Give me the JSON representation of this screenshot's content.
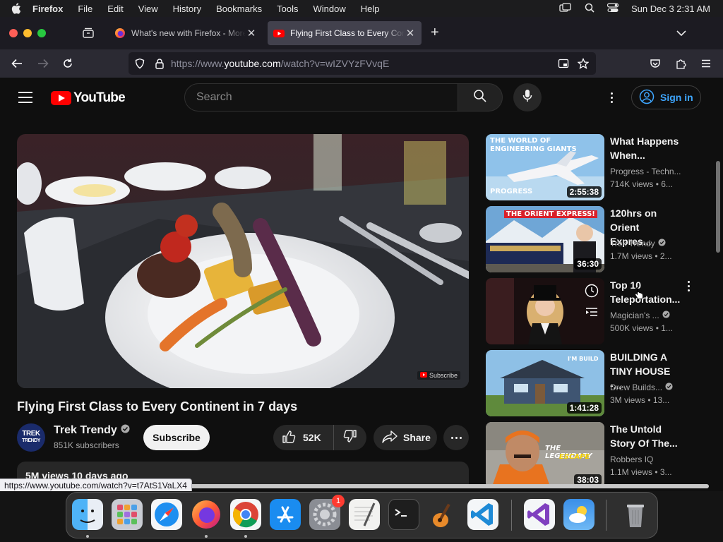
{
  "menubar": {
    "app_name": "Firefox",
    "items": [
      "File",
      "Edit",
      "View",
      "History",
      "Bookmarks",
      "Tools",
      "Window",
      "Help"
    ],
    "clock": "Sun Dec 3  2:31 AM"
  },
  "tabs": [
    {
      "title": "What's new with Firefox - More",
      "active": false
    },
    {
      "title": "Flying First Class to Every Conti",
      "active": true
    }
  ],
  "urlbar": {
    "prefix": "https://www.",
    "domain": "youtube.com",
    "path": "/watch?v=wIZVYzFVvqE"
  },
  "youtube": {
    "logo_text": "YouTube",
    "search_placeholder": "Search",
    "sign_in": "Sign in",
    "video": {
      "title": "Flying First Class to Every Continent in 7 days",
      "watermark": "Subscribe",
      "channel": "Trek Trendy",
      "channel_avatar_line1": "TREK",
      "channel_avatar_line2": "TRENDY",
      "subscribers": "851K subscribers",
      "subscribe_label": "Subscribe",
      "likes": "52K",
      "share_label": "Share",
      "description_stats": "5M views  10 days ago"
    },
    "recommendations": [
      {
        "title_1": "What Happens",
        "title_2": "When...",
        "channel": "Progress - Techn...",
        "verified": false,
        "views": "714K views  • 6...",
        "duration": "2:55:38",
        "thumb_text_1": "THE WORLD OF",
        "thumb_text_2": "ENGINEERING GIANTS",
        "thumb_text_3": "PROGRESS"
      },
      {
        "title_1": "120hrs on",
        "title_2": "Orient Expres...",
        "channel": "Trek Trendy",
        "verified": true,
        "views": "1.7M views  • 2...",
        "duration": "36:30",
        "thumb_text_1": "THE ORIENT EXPRESS!"
      },
      {
        "title_1": "Top 10",
        "title_2": "Teleportation...",
        "channel": "Magician's ...",
        "verified": true,
        "views": "500K views  • 1...",
        "duration": ""
      },
      {
        "title_1": "BUILDING A",
        "title_2": "TINY HOUSE -...",
        "channel": "Drew Builds...",
        "verified": true,
        "views": "3M views  • 13...",
        "duration": "1:41:28",
        "thumb_text_1": "I'M BUILD"
      },
      {
        "title_1": "The Untold",
        "title_2": "Story Of The...",
        "channel": "Robbers IQ",
        "verified": false,
        "views": "1.1M views  • 3...",
        "duration": "38:03",
        "thumb_text_1": "THE LEGENDARY",
        "thumb_text_2": "ESCAPE"
      }
    ]
  },
  "status_url": "https://www.youtube.com/watch?v=t7AtS1VaLX4",
  "dock": {
    "apps": [
      "finder-icon",
      "launchpad-icon",
      "safari-icon",
      "firefox-icon",
      "chrome-icon",
      "app-store-icon",
      "system-settings-icon",
      "textedit-icon",
      "terminal-icon",
      "garageband-icon",
      "vscode-icon",
      "visual-studio-icon",
      "weather-icon",
      "trash-icon"
    ],
    "settings_badge": "1"
  },
  "colors": {
    "youtube_red": "#ff0000",
    "accent_blue": "#3ea6ff",
    "background": "#0f0f0f"
  }
}
